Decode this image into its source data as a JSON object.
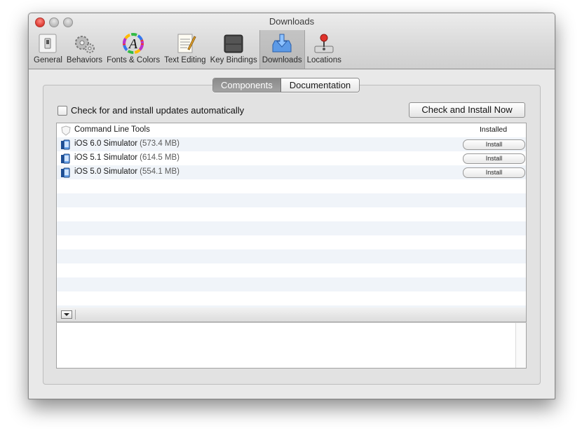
{
  "window": {
    "title": "Downloads"
  },
  "toolbar": {
    "items": [
      {
        "label": "General",
        "icon": "switch-icon"
      },
      {
        "label": "Behaviors",
        "icon": "gears-icon"
      },
      {
        "label": "Fonts & Colors",
        "icon": "color-wheel-icon"
      },
      {
        "label": "Text Editing",
        "icon": "notepad-pencil-icon"
      },
      {
        "label": "Key Bindings",
        "icon": "keys-icon"
      },
      {
        "label": "Downloads",
        "icon": "download-tray-icon",
        "selected": true
      },
      {
        "label": "Locations",
        "icon": "joystick-icon"
      }
    ]
  },
  "tabs": {
    "components": "Components",
    "documentation": "Documentation",
    "selected": "Components"
  },
  "auto_update": {
    "label": "Check for and install updates automatically",
    "checked": false
  },
  "check_button": {
    "label": "Check and Install Now"
  },
  "components": [
    {
      "name": "Command Line Tools",
      "size": "",
      "status": "Installed",
      "icon": "shield-icon"
    },
    {
      "name": "iOS 6.0 Simulator",
      "size": "(573.4 MB)",
      "action": "Install",
      "icon": "simulator-icon"
    },
    {
      "name": "iOS 5.1 Simulator",
      "size": "(614.5 MB)",
      "action": "Install",
      "icon": "simulator-icon"
    },
    {
      "name": "iOS 5.0 Simulator",
      "size": "(554.1 MB)",
      "action": "Install",
      "icon": "simulator-icon"
    }
  ],
  "colors": {
    "accent": "#3a7fd6",
    "row_alt": "#f0f4f9",
    "close": "#dd3b33"
  }
}
